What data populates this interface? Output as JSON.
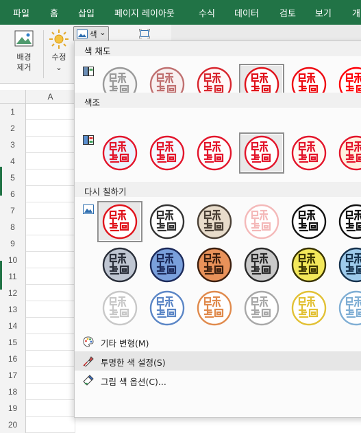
{
  "menubar": {
    "items": [
      "파일",
      "홈",
      "삽입",
      "페이지 레이아웃",
      "수식",
      "데이터",
      "검토",
      "보기",
      "개"
    ]
  },
  "ribbon": {
    "remove_bg_label_1": "배경",
    "remove_bg_label_2": "제거",
    "corrections_label": "수정",
    "corrections_arrow": "⌄",
    "color_button_label": "색",
    "color_button_arrow": "⌄"
  },
  "sheet": {
    "column_a": "A",
    "rows": [
      "1",
      "2",
      "3",
      "4",
      "5",
      "6",
      "7",
      "8",
      "9",
      "10",
      "11",
      "12",
      "13",
      "14",
      "15",
      "16",
      "17",
      "18",
      "19",
      "20"
    ]
  },
  "panel": {
    "saturation_title": "색 채도",
    "tone_title": "색조",
    "recolor_title": "다시 칠하기",
    "menu": {
      "more_variations": "기타 변형(M)",
      "set_transparent": "투명한 색 설정(S)",
      "picture_color_options": "그림 색 옵션(C)..."
    }
  },
  "swatches": {
    "saturation": [
      {
        "stroke": "#9a9a9a",
        "fill": "#f6f6f6",
        "selected": false
      },
      {
        "stroke": "#c07070",
        "fill": "#f8f0f0",
        "selected": false
      },
      {
        "stroke": "#d8262e",
        "fill": "#fff8f8",
        "selected": false
      },
      {
        "stroke": "#e0131b",
        "fill": "#ffffff",
        "selected": true
      },
      {
        "stroke": "#ee0a12",
        "fill": "#ffffff",
        "selected": false
      },
      {
        "stroke": "#ff0008",
        "fill": "#ffffff",
        "selected": false
      }
    ],
    "tone": [
      {
        "stroke": "#e3152b",
        "fill": "#eaf3ff",
        "selected": false
      },
      {
        "stroke": "#e3152b",
        "fill": "#f4f8ff",
        "selected": false
      },
      {
        "stroke": "#e3152b",
        "fill": "#fdfdfd",
        "selected": false
      },
      {
        "stroke": "#e3152b",
        "fill": "#ffffff",
        "selected": true
      },
      {
        "stroke": "#e3152b",
        "fill": "#fff9f2",
        "selected": false
      },
      {
        "stroke": "#e3152b",
        "fill": "#fff1e0",
        "selected": false
      }
    ],
    "recolor": [
      {
        "stroke": "#e0131b",
        "fill": "#ffffff",
        "selected": true
      },
      {
        "stroke": "#333333",
        "fill": "#ffffff",
        "selected": false
      },
      {
        "stroke": "#4a4036",
        "fill": "#e8dccb",
        "selected": false
      },
      {
        "stroke": "#f4b9b9",
        "fill": "#ffffff",
        "selected": false
      },
      {
        "stroke": "#111111",
        "fill": "#ffffff",
        "selected": false
      },
      {
        "stroke": "#111111",
        "fill": "#ffffff",
        "selected": false
      },
      {
        "stroke": "#2a2f3a",
        "fill": "#bfc6d2",
        "selected": false
      },
      {
        "stroke": "#1c2a5a",
        "fill": "#7aa0dc",
        "selected": false
      },
      {
        "stroke": "#3b1e0e",
        "fill": "#e9925a",
        "selected": false
      },
      {
        "stroke": "#2a2a2a",
        "fill": "#c9c9c9",
        "selected": false
      },
      {
        "stroke": "#3a3400",
        "fill": "#f3e85a",
        "selected": false
      },
      {
        "stroke": "#16324d",
        "fill": "#9ecbec",
        "selected": false
      },
      {
        "stroke": "#c8c8c8",
        "fill": "#ffffff",
        "selected": false
      },
      {
        "stroke": "#5b86c6",
        "fill": "#ffffff",
        "selected": false
      },
      {
        "stroke": "#e08a4c",
        "fill": "#ffffff",
        "selected": false
      },
      {
        "stroke": "#a8a8a8",
        "fill": "#ffffff",
        "selected": false
      },
      {
        "stroke": "#e2c135",
        "fill": "#ffffff",
        "selected": false
      },
      {
        "stroke": "#7faed4",
        "fill": "#ffffff",
        "selected": false
      }
    ]
  }
}
